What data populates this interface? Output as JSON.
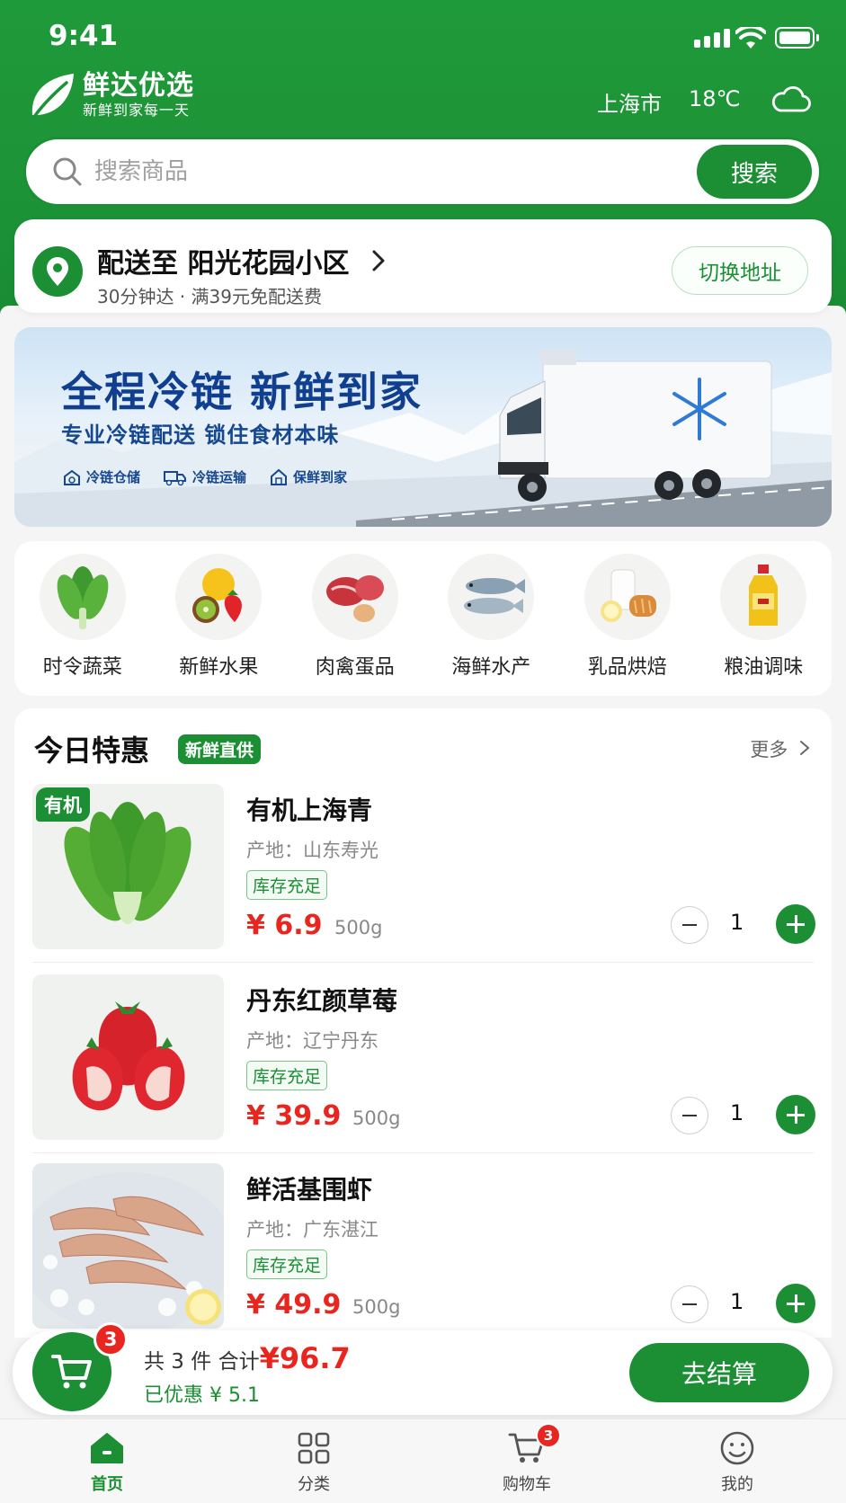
{
  "status_bar": {
    "time": "9:41"
  },
  "header": {
    "brand_name": "鲜达优选",
    "brand_slogan": "新鲜到家每一天",
    "city": "上海市",
    "temperature": "18℃",
    "weather_icon": "cloud-icon"
  },
  "search": {
    "placeholder": "搜索商品",
    "button_label": "搜索"
  },
  "delivery": {
    "title": "配送至  阳光花园小区",
    "subtitle": "30分钟达 · 满39元免配送费",
    "switch_label": "切换地址"
  },
  "banner": {
    "headline": "全程冷链  新鲜到家",
    "subline": "专业冷链配送  锁住食材本味",
    "features": [
      "冷链仓储",
      "冷链运输",
      "保鲜到家"
    ]
  },
  "categories": [
    {
      "label": "时令蔬菜",
      "icon": "vegetable-icon"
    },
    {
      "label": "新鲜水果",
      "icon": "fruit-icon"
    },
    {
      "label": "肉禽蛋品",
      "icon": "meat-icon"
    },
    {
      "label": "海鲜水产",
      "icon": "fish-icon"
    },
    {
      "label": "乳品烘焙",
      "icon": "dairy-icon"
    },
    {
      "label": "粮油调味",
      "icon": "oil-icon"
    }
  ],
  "deals": {
    "title": "今日特惠",
    "tag": "新鲜直供",
    "more_label": "更多",
    "items": [
      {
        "badge": "有机",
        "name": "有机上海青",
        "origin": "产地：山东寿光",
        "stock": "库存充足",
        "price": "¥ 6.9",
        "unit": "500g",
        "qty": "1"
      },
      {
        "badge": "",
        "name": "丹东红颜草莓",
        "origin": "产地：辽宁丹东",
        "stock": "库存充足",
        "price": "¥ 39.9",
        "unit": "500g",
        "qty": "1"
      },
      {
        "badge": "",
        "name": "鲜活基围虾",
        "origin": "产地：广东湛江",
        "stock": "库存充足",
        "price": "¥ 49.9",
        "unit": "500g",
        "qty": "1"
      }
    ]
  },
  "cart": {
    "count": "3",
    "summary_prefix": "共 3 件   合计",
    "total": "¥96.7",
    "saved": "已优惠 ¥ 5.1",
    "checkout_label": "去结算"
  },
  "tabbar": {
    "items": [
      {
        "label": "首页",
        "icon": "home-icon",
        "active": true
      },
      {
        "label": "分类",
        "icon": "grid-icon",
        "active": false
      },
      {
        "label": "购物车",
        "icon": "cart-icon",
        "active": false,
        "badge": "3"
      },
      {
        "label": "我的",
        "icon": "profile-icon",
        "active": false
      }
    ]
  },
  "colors": {
    "brand_green": "#1c8f35",
    "price_red": "#e8261f"
  }
}
